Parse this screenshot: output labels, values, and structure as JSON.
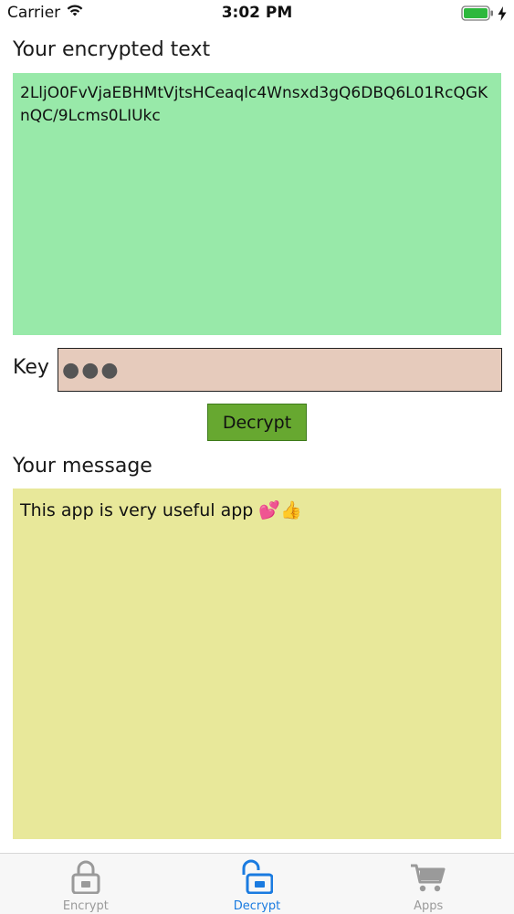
{
  "status_bar": {
    "carrier": "Carrier",
    "time": "3:02 PM"
  },
  "encrypted": {
    "label": "Your encrypted text",
    "value": "2LljO0FvVjaEBHMtVjtsHCeaqlc4Wnsxd3gQ6DBQ6L01RcQGKnQC/9Lcms0LIUkc"
  },
  "key": {
    "label": "Key",
    "masked_value": "●●●"
  },
  "actions": {
    "decrypt_label": "Decrypt"
  },
  "message": {
    "label": "Your message",
    "value": "This app is very useful app 💕👍"
  },
  "tabs": [
    {
      "label": "Encrypt",
      "icon": "lock-closed-icon",
      "active": false
    },
    {
      "label": "Decrypt",
      "icon": "lock-open-icon",
      "active": true
    },
    {
      "label": "Apps",
      "icon": "cart-icon",
      "active": false
    }
  ],
  "colors": {
    "encrypted_bg": "#98e9a9",
    "key_bg": "#e6cbbc",
    "decrypt_button": "#67a830",
    "message_bg": "#e8e89a",
    "tab_active": "#1a7be0",
    "tab_inactive": "#9a9a9a"
  }
}
